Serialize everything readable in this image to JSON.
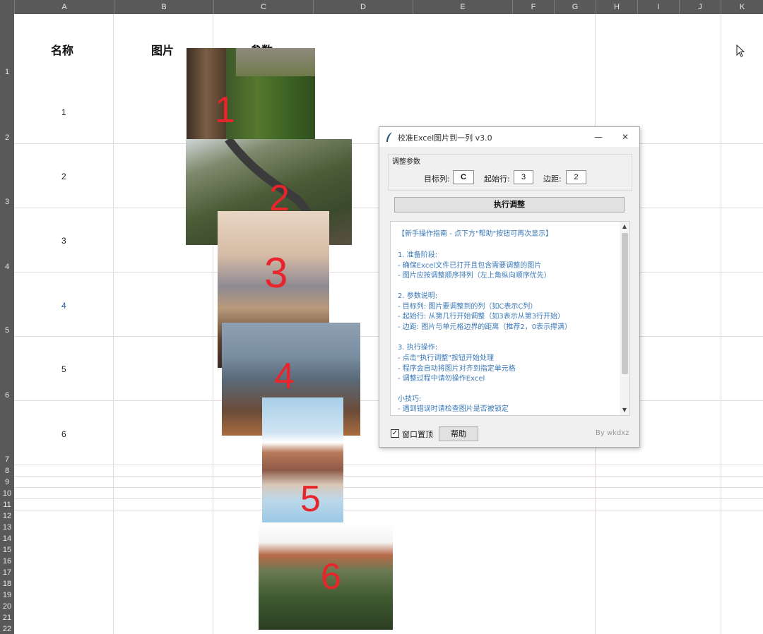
{
  "spreadsheet": {
    "columns": [
      "A",
      "B",
      "C",
      "D",
      "E",
      "F",
      "G",
      "H",
      "I",
      "J",
      "K"
    ],
    "rows": [
      "1",
      "2",
      "3",
      "4",
      "5",
      "6",
      "7",
      "8",
      "9",
      "10",
      "11",
      "12",
      "13",
      "14",
      "15",
      "16",
      "17",
      "18",
      "19",
      "20",
      "21",
      "22"
    ],
    "headers": {
      "name": "名称",
      "image": "图片",
      "param": "参数"
    },
    "names": [
      "1",
      "2",
      "3",
      "4",
      "5",
      "6"
    ]
  },
  "photos": [
    {
      "label": "1",
      "scene": "tree-trunk-palms"
    },
    {
      "label": "2",
      "scene": "mountain-road"
    },
    {
      "label": "3",
      "scene": "mountain-desert"
    },
    {
      "label": "4",
      "scene": "mountain-forest"
    },
    {
      "label": "5",
      "scene": "lake-mountain"
    },
    {
      "label": "6",
      "scene": "hillside-village"
    }
  ],
  "dialog": {
    "title": "校准Excel图片到一列 v3.0",
    "minimize": "—",
    "close": "✕",
    "group_title": "调整参数",
    "target_col_label": "目标列:",
    "target_col_value": "C",
    "start_row_label": "起始行:",
    "start_row_value": "3",
    "margin_label": "边距:",
    "margin_value": "2",
    "execute_label": "执行调整",
    "guide_lines": [
      "【新手操作指南 - 点下方\"帮助\"按钮可再次显示】",
      "",
      "1. 准备阶段:",
      "   - 确保Excel文件已打开且包含需要调整的图片",
      "   - 图片应按调整顺序排列（左上角纵向顺序优先）",
      "",
      "2. 参数说明:",
      "   - 目标列: 图片要调整到的列（如C表示C列）",
      "   - 起始行: 从第几行开始调整（如3表示从第3行开始）",
      "   - 边距: 图片与单元格边界的距离（推荐2，0表示撑满）",
      "",
      "3. 执行操作:",
      "   - 点击\"执行调整\"按钮开始处理",
      "   - 程序会自动将图片对齐到指定单元格",
      "   - 调整过程中请勿操作Excel",
      "",
      "小技巧:",
      "- 遇到错误时请检查图片是否被锁定"
    ],
    "topmost_label": "窗口置顶",
    "topmost_checked": "✓",
    "help_label": "帮助",
    "byline": "By wkdxz"
  },
  "colors": {
    "header_bg": "#595959",
    "gridline": "#e3d9de",
    "guide_text": "#3b79b8",
    "photo_label": "#e8252b"
  }
}
